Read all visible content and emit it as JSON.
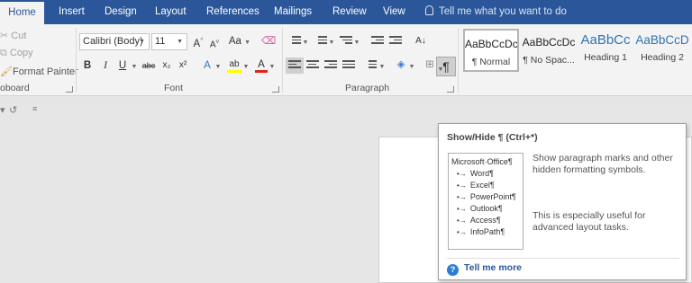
{
  "tabs": [
    {
      "label": "Home",
      "active": true
    },
    {
      "label": "Insert"
    },
    {
      "label": "Design"
    },
    {
      "label": "Layout"
    },
    {
      "label": "References"
    },
    {
      "label": "Mailings"
    },
    {
      "label": "Review"
    },
    {
      "label": "View"
    }
  ],
  "tell_me": "Tell me what you want to do",
  "clipboard": {
    "cut": "Cut",
    "copy": "Copy",
    "format_painter": "Format Painter",
    "label": "oboard"
  },
  "font": {
    "name": "Calibri (Body)",
    "size": "11",
    "grow": "A",
    "shrink": "A",
    "change_case": "Aa",
    "bold": "B",
    "italic": "I",
    "underline": "U",
    "strikethrough": "abc",
    "subscript": "x₂",
    "superscript": "x²",
    "text_effects": "A",
    "highlight": "ab",
    "font_color": "A",
    "label": "Font"
  },
  "paragraph": {
    "sort": "A↓",
    "show_hide": "¶",
    "label": "Paragraph"
  },
  "styles": [
    {
      "sample": "AaBbCcDc",
      "name": "¶ Normal",
      "selected": true
    },
    {
      "sample": "AaBbCcDc",
      "name": "¶ No Spac..."
    },
    {
      "sample": "AaBbCc",
      "name": "Heading 1"
    },
    {
      "sample": "AaBbCcD",
      "name": "Heading 2"
    }
  ],
  "qat": {
    "redo": "↺",
    "customize": "≡"
  },
  "tooltip": {
    "title": "Show/Hide ¶ (Ctrl+*)",
    "preview": {
      "title": "Microsoft·Office¶",
      "items": [
        "Word¶",
        "Excel¶",
        "PowerPoint¶",
        "Outlook¶",
        "Access¶",
        "InfoPath¶"
      ]
    },
    "description": "Show paragraph marks and other hidden formatting symbols.",
    "extra": "This is especially useful for advanced layout tasks.",
    "help": "Tell me more"
  },
  "colors": {
    "accent": "#2b579a",
    "highlight": "#ffff00",
    "font_color": "#e0241b",
    "heading": "#2e74b5"
  },
  "icons": [
    "scissors-icon",
    "copy-icon",
    "brush-icon",
    "lightbulb-icon",
    "help-icon",
    "pilcrow-icon"
  ]
}
